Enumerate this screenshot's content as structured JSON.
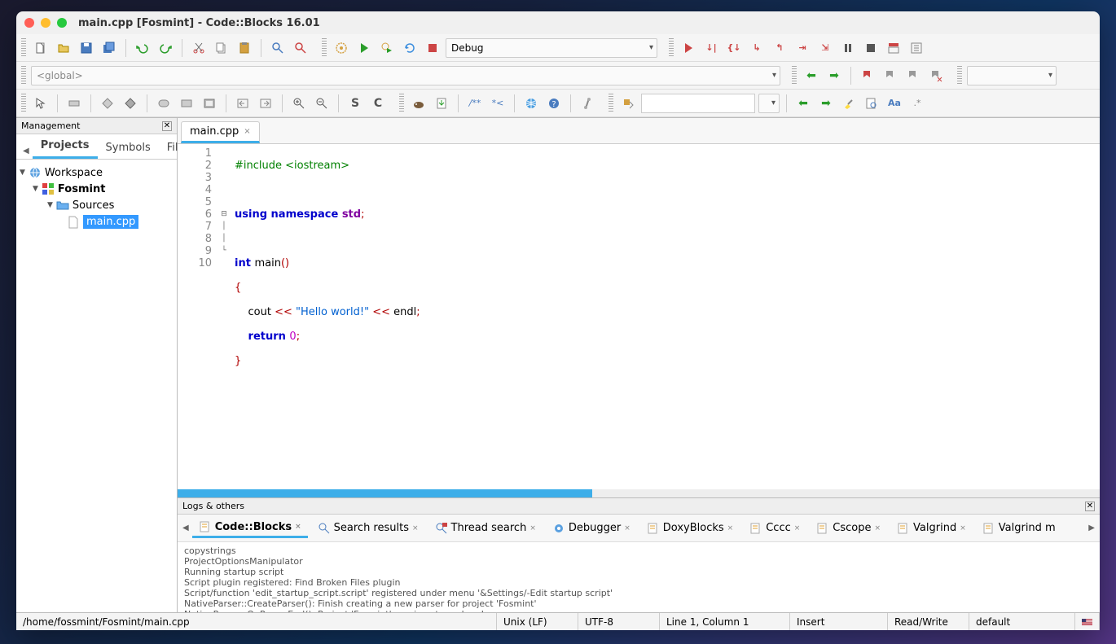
{
  "window": {
    "title": "main.cpp [Fosmint] - Code::Blocks 16.01"
  },
  "toolbar": {
    "build_target": "Debug",
    "scope": "<global>"
  },
  "management": {
    "title": "Management",
    "tabs": [
      "Projects",
      "Symbols",
      "Fil"
    ],
    "tree": {
      "workspace": "Workspace",
      "project": "Fosmint",
      "folder": "Sources",
      "file": "main.cpp"
    }
  },
  "editor": {
    "tab": "main.cpp",
    "linenums": [
      "1",
      "2",
      "3",
      "4",
      "5",
      "6",
      "7",
      "8",
      "9",
      "10"
    ],
    "code": {
      "l1_a": "#include ",
      "l1_b": "<iostream>",
      "l3_a": "using ",
      "l3_b": "namespace ",
      "l3_c": "std",
      "l3_d": ";",
      "l5_a": "int ",
      "l5_b": "main",
      "l5_c": "()",
      "l6": "{",
      "l7_a": "    cout ",
      "l7_b": "<<",
      "l7_c": " \"Hello world!\" ",
      "l7_d": "<<",
      "l7_e": " endl",
      "l7_f": ";",
      "l8_a": "    ",
      "l8_b": "return ",
      "l8_c": "0",
      "l8_d": ";",
      "l9": "}"
    }
  },
  "logs": {
    "title": "Logs & others",
    "tabs": [
      "Code::Blocks",
      "Search results",
      "Thread search",
      "Debugger",
      "DoxyBlocks",
      "Cccc",
      "Cscope",
      "Valgrind",
      "Valgrind m"
    ],
    "lines": [
      "copystrings",
      "ProjectOptionsManipulator",
      "Running startup script",
      "Script plugin registered: Find Broken Files plugin",
      "Script/function 'edit_startup_script.script' registered under menu '&Settings/-Edit startup script'",
      "NativeParser::CreateParser(): Finish creating a new parser for project 'Fosmint'",
      "NativeParser::OnParserEnd(): Project 'Fosmint' parsing stage done!"
    ]
  },
  "status": {
    "path": "/home/fossmint/Fosmint/main.cpp",
    "eol": "Unix (LF)",
    "enc": "UTF-8",
    "pos": "Line 1, Column 1",
    "ins": "Insert",
    "rw": "Read/Write",
    "profile": "default"
  }
}
